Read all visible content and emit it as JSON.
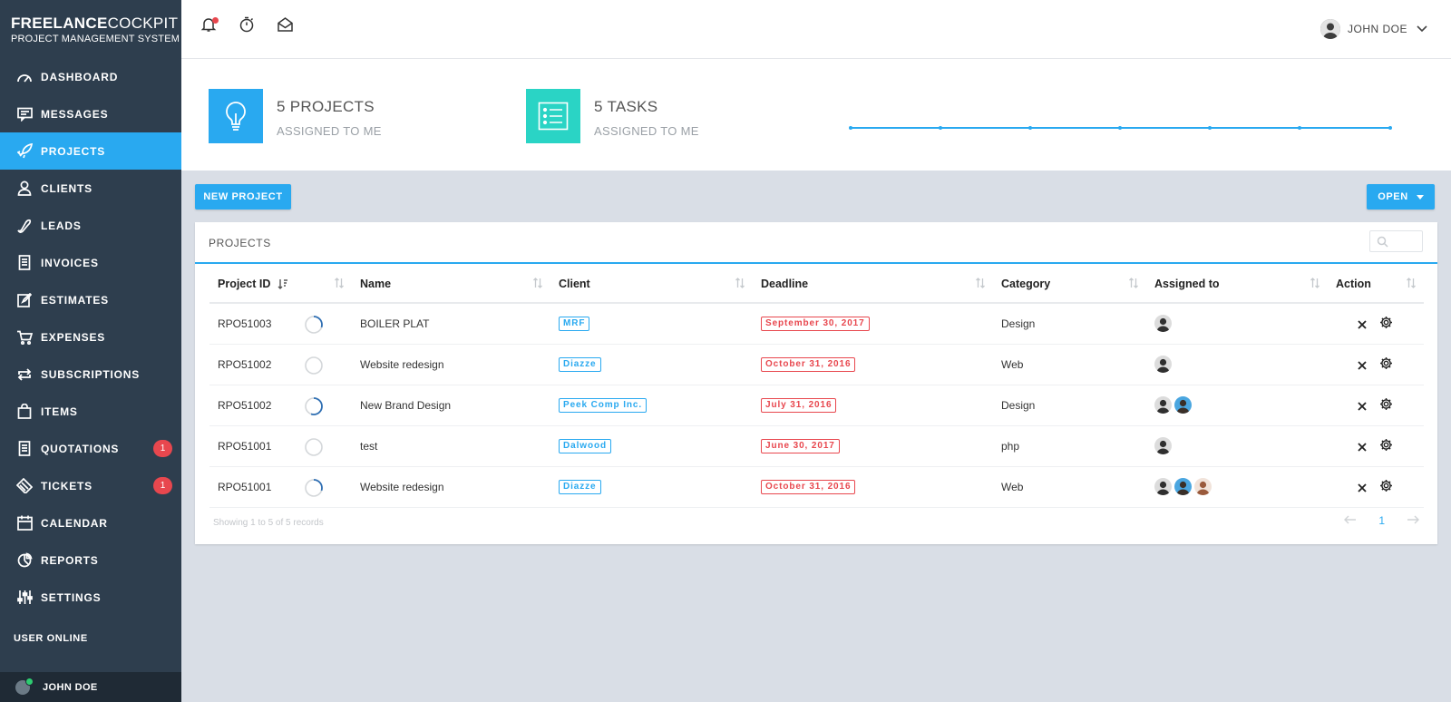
{
  "brand": {
    "name_bold": "FREELANCE",
    "name_light": "COCKPIT",
    "tagline": "PROJECT MANAGEMENT SYSTEM"
  },
  "sidebar": {
    "items": [
      {
        "label": "DASHBOARD",
        "icon": "gauge-icon"
      },
      {
        "label": "MESSAGES",
        "icon": "message-icon"
      },
      {
        "label": "PROJECTS",
        "icon": "rocket-icon",
        "active": true
      },
      {
        "label": "CLIENTS",
        "icon": "user-icon"
      },
      {
        "label": "LEADS",
        "icon": "phone-icon"
      },
      {
        "label": "INVOICES",
        "icon": "document-icon"
      },
      {
        "label": "ESTIMATES",
        "icon": "edit-icon"
      },
      {
        "label": "EXPENSES",
        "icon": "cart-icon"
      },
      {
        "label": "SUBSCRIPTIONS",
        "icon": "repeat-icon"
      },
      {
        "label": "ITEMS",
        "icon": "bag-icon"
      },
      {
        "label": "QUOTATIONS",
        "icon": "document-icon",
        "badge": "1"
      },
      {
        "label": "TICKETS",
        "icon": "ticket-icon",
        "badge": "1"
      },
      {
        "label": "CALENDAR",
        "icon": "calendar-icon"
      },
      {
        "label": "REPORTS",
        "icon": "chart-icon"
      },
      {
        "label": "SETTINGS",
        "icon": "sliders-icon"
      }
    ],
    "user_online_title": "USER ONLINE",
    "online_user": "JOHN DOE"
  },
  "topbar": {
    "user_name": "JOHN DOE"
  },
  "stats": {
    "projects": {
      "value": "5 PROJECTS",
      "sub": "ASSIGNED TO ME"
    },
    "tasks": {
      "value": "5 TASKS",
      "sub": "ASSIGNED TO ME"
    }
  },
  "toolbar": {
    "new_project": "NEW PROJECT",
    "filter": "OPEN"
  },
  "panel": {
    "title": "PROJECTS",
    "columns": [
      "Project ID",
      "Name",
      "Client",
      "Deadline",
      "Category",
      "Assigned to",
      "Action"
    ],
    "rows": [
      {
        "id": "RPO51003",
        "progress": 0.3,
        "name": "BOILER PLAT",
        "client": "MRF",
        "deadline": "September 30, 2017",
        "category": "Design",
        "assigned": 1
      },
      {
        "id": "RPO51002",
        "progress": 0,
        "name": "Website redesign",
        "client": "Diazze",
        "deadline": "October 31, 2016",
        "category": "Web",
        "assigned": 1
      },
      {
        "id": "RPO51002",
        "progress": 0.55,
        "name": "New Brand Design",
        "client": "Peek Comp Inc.",
        "deadline": "July 31, 2016",
        "category": "Design",
        "assigned": 2
      },
      {
        "id": "RPO51001",
        "progress": 0,
        "name": "test",
        "client": "Dalwood",
        "deadline": "June 30, 2017",
        "category": "php",
        "assigned": 1
      },
      {
        "id": "RPO51001",
        "progress": 0.3,
        "name": "Website redesign",
        "client": "Diazze",
        "deadline": "October 31, 2016",
        "category": "Web",
        "assigned": 3
      }
    ],
    "footer": "Showing 1 to 5 of 5 records",
    "page": "1"
  },
  "colors": {
    "sidebar": "#2e3e4e",
    "accent": "#29a9f0",
    "teal": "#2ad4c5",
    "danger": "#e8474e"
  }
}
